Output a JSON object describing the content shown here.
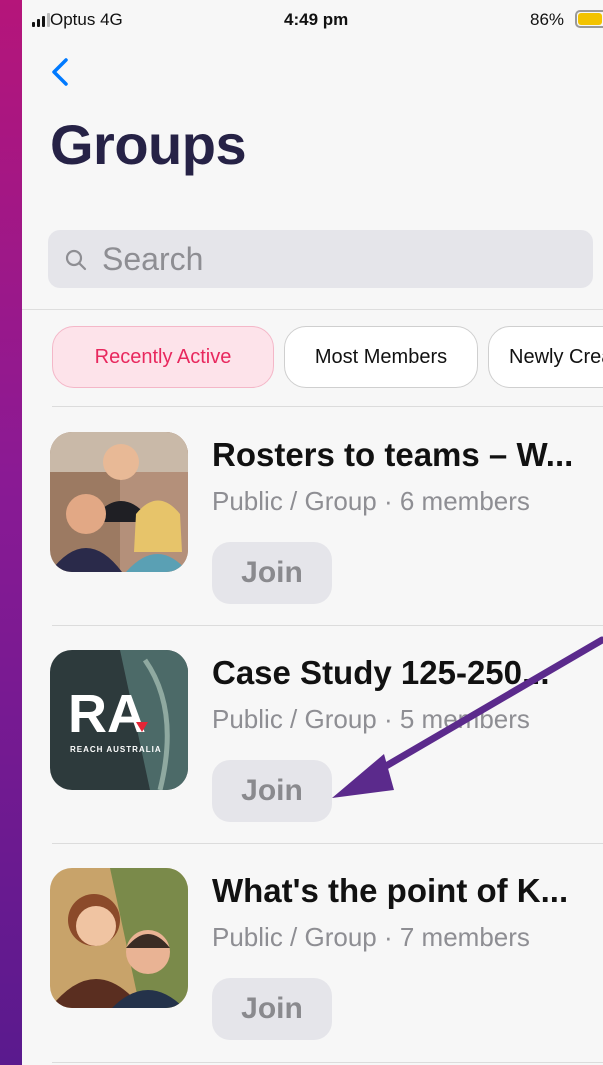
{
  "status_bar": {
    "carrier": "Optus  4G",
    "time": "4:49 pm",
    "battery": "86%"
  },
  "header": {
    "title": "Groups"
  },
  "search": {
    "placeholder": "Search"
  },
  "filters": [
    {
      "label": "Recently Active",
      "active": true
    },
    {
      "label": "Most Members",
      "active": false
    },
    {
      "label": "Newly Crea",
      "active": false
    }
  ],
  "groups": [
    {
      "name": "Rosters to teams – W...",
      "meta": "Public / Group · 6 members",
      "join_label": "Join",
      "thumb_icon": "group-photo-three-people"
    },
    {
      "name": "Case Study 125-250...",
      "meta": "Public / Group · 5 members",
      "join_label": "Join",
      "thumb_icon": "reach-australia-logo",
      "logo_text": "RA",
      "logo_caption": "REACH AUSTRALIA"
    },
    {
      "name": "What's the point of K...",
      "meta": "Public / Group · 7 members",
      "join_label": "Join",
      "thumb_icon": "group-photo-two-people"
    }
  ],
  "colors": {
    "accent": "#007aff",
    "title": "#262246",
    "chip_active_bg": "#fde3ea",
    "chip_active_text": "#e8285e",
    "annotation_arrow": "#5b2a8c"
  }
}
